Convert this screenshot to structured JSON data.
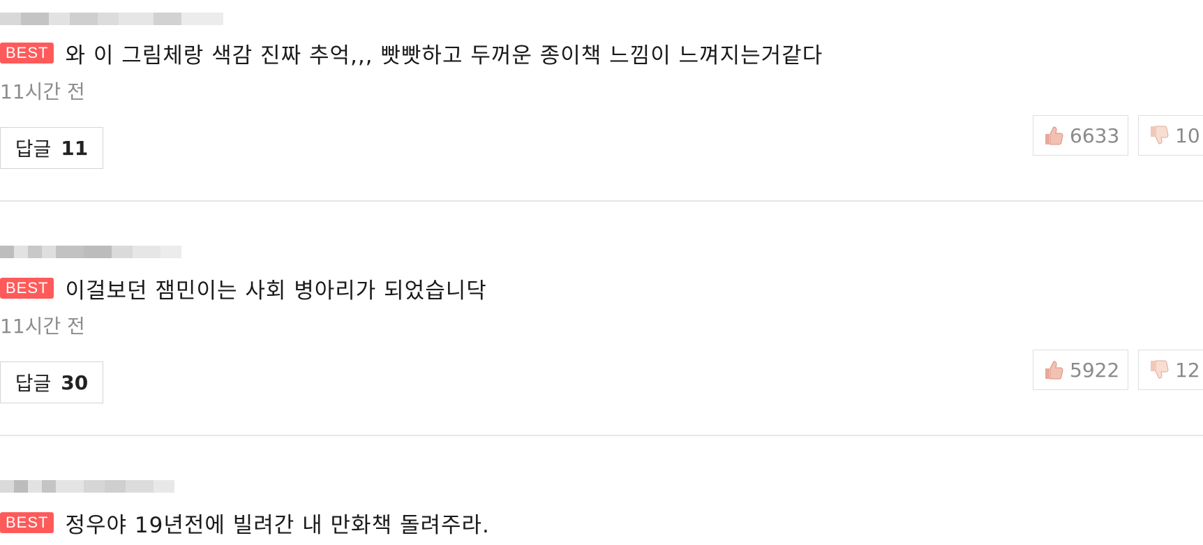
{
  "badge_label": "BEST",
  "reply_label": "답글",
  "comments": [
    {
      "text": "와 이 그림체랑 색감 진짜 추억,,, 빳빳하고 두꺼운 종이책 느낌이 느껴지는거같다",
      "time": "11시간 전",
      "reply_count": "11",
      "likes": "6633",
      "dislikes": "10"
    },
    {
      "text": "이걸보던 잼민이는 사회 병아리가 되었습니닥",
      "time": "11시간 전",
      "reply_count": "30",
      "likes": "5922",
      "dislikes": "12"
    },
    {
      "text": "정우야 19년전에 빌려간 내 만화책 돌려주라.",
      "time": "",
      "reply_count": "",
      "likes": "",
      "dislikes": ""
    }
  ],
  "colors": {
    "badge": "#ff5a5a",
    "divider": "#e6e6e6",
    "time": "#8c8c8c"
  },
  "icons": {
    "like": "thumbs-up-icon",
    "dislike": "thumbs-down-icon"
  }
}
